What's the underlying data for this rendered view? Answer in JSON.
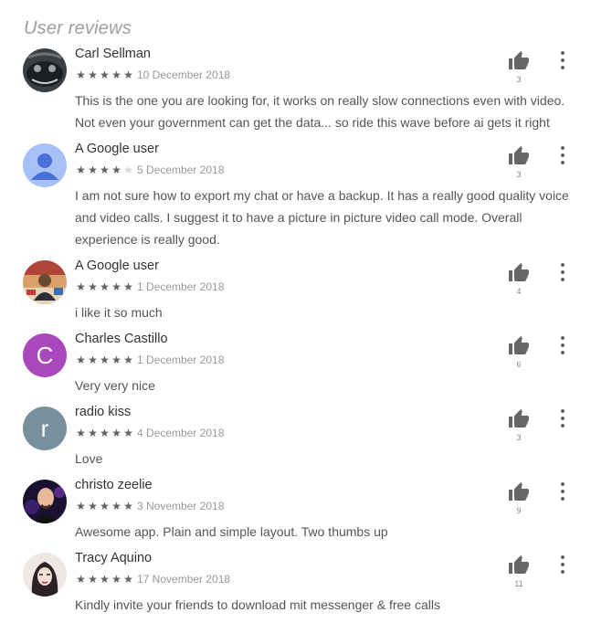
{
  "section_title": "User reviews",
  "colors": {
    "star_on": "#616161",
    "star_off": "#d6d6d6",
    "text": "#555555",
    "meta": "#999999"
  },
  "reviews": [
    {
      "name": "Carl Sellman",
      "rating": 5,
      "date": "10 December 2018",
      "text": "This is the one you are looking for, it works on really slow connections even with video. Not even your government can get the data... so ride this wave before ai gets it right",
      "helpful_count": "3",
      "avatar": {
        "type": "photo",
        "icon": "dark-creature-photo"
      }
    },
    {
      "name": "A Google user",
      "rating": 4,
      "date": "5 December 2018",
      "text": "I am not sure how to export my chat or have a backup. It has a really good quality voice and video calls. I suggest it to have a picture in picture video call mode. Overall experience is really good.",
      "helpful_count": "3",
      "avatar": {
        "type": "default",
        "icon": "default-person-icon",
        "color": "#a7c0f5"
      }
    },
    {
      "name": "A Google user",
      "rating": 5,
      "date": "1 December 2018",
      "text": "i like it so much",
      "helpful_count": "4",
      "avatar": {
        "type": "photo",
        "icon": "person-photo"
      }
    },
    {
      "name": "Charles Castillo",
      "rating": 5,
      "date": "1 December 2018",
      "text": "Very very nice",
      "helpful_count": "6",
      "avatar": {
        "type": "letter",
        "letter": "C",
        "color": "#ab47bc"
      }
    },
    {
      "name": "radio kiss",
      "rating": 5,
      "date": "4 December 2018",
      "text": "Love",
      "helpful_count": "3",
      "avatar": {
        "type": "letter",
        "letter": "r",
        "color": "#78909c"
      }
    },
    {
      "name": "christo zeelie",
      "rating": 5,
      "date": "3 November 2018",
      "text": "Awesome app. Plain and simple layout. Two thumbs up",
      "helpful_count": "9",
      "avatar": {
        "type": "photo",
        "icon": "bald-man-photo"
      }
    },
    {
      "name": "Tracy Aquino",
      "rating": 5,
      "date": "17 November 2018",
      "text": "Kindly invite your friends to download mit messenger & free calls",
      "helpful_count": "11",
      "avatar": {
        "type": "photo",
        "icon": "woman-sketch-photo"
      }
    }
  ]
}
